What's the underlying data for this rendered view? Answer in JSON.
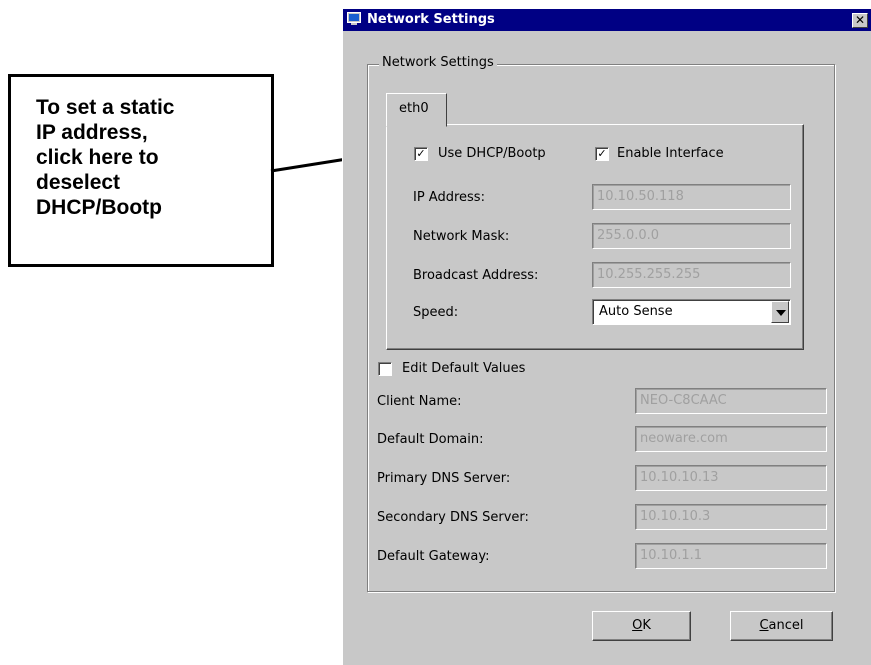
{
  "callout": {
    "text": "To set a static\nIP address,\nclick here to\ndeselect\nDHCP/Bootp"
  },
  "window": {
    "title": "Network Settings",
    "close_glyph": "✕",
    "group_label": "Network Settings",
    "tab_label": "eth0",
    "use_dhcp": {
      "label": "Use DHCP/Bootp",
      "checked": true,
      "mark": "✓"
    },
    "enable_interface": {
      "label": "Enable Interface",
      "checked": true,
      "mark": "✓"
    },
    "ip_address": {
      "label": "IP Address:",
      "value": "10.10.50.118"
    },
    "network_mask": {
      "label": "Network Mask:",
      "value": "255.0.0.0"
    },
    "broadcast_address": {
      "label": "Broadcast Address:",
      "value": "10.255.255.255"
    },
    "speed": {
      "label": "Speed:",
      "value": "Auto Sense"
    },
    "edit_defaults": {
      "label": "Edit Default Values",
      "checked": false
    },
    "client_name": {
      "label": "Client Name:",
      "value": "NEO-C8CAAC"
    },
    "default_domain": {
      "label": "Default Domain:",
      "value": "neoware.com"
    },
    "primary_dns": {
      "label": "Primary DNS Server:",
      "value": "10.10.10.13"
    },
    "secondary_dns": {
      "label": "Secondary DNS Server:",
      "value": "10.10.10.3"
    },
    "default_gateway": {
      "label": "Default Gateway:",
      "value": "10.10.1.1"
    },
    "ok": {
      "label_rest": "K",
      "underline": "O"
    },
    "cancel": {
      "label_rest": "ancel",
      "underline": "C"
    }
  },
  "colors": {
    "titlebar": "#000084",
    "dialog_bg": "#c8c8c8",
    "disabled_text": "#a0a0a0"
  },
  "icons": [
    "monitor-icon",
    "close-icon",
    "checkmark-icon",
    "dropdown-arrow-icon",
    "pointer-arrow"
  ]
}
